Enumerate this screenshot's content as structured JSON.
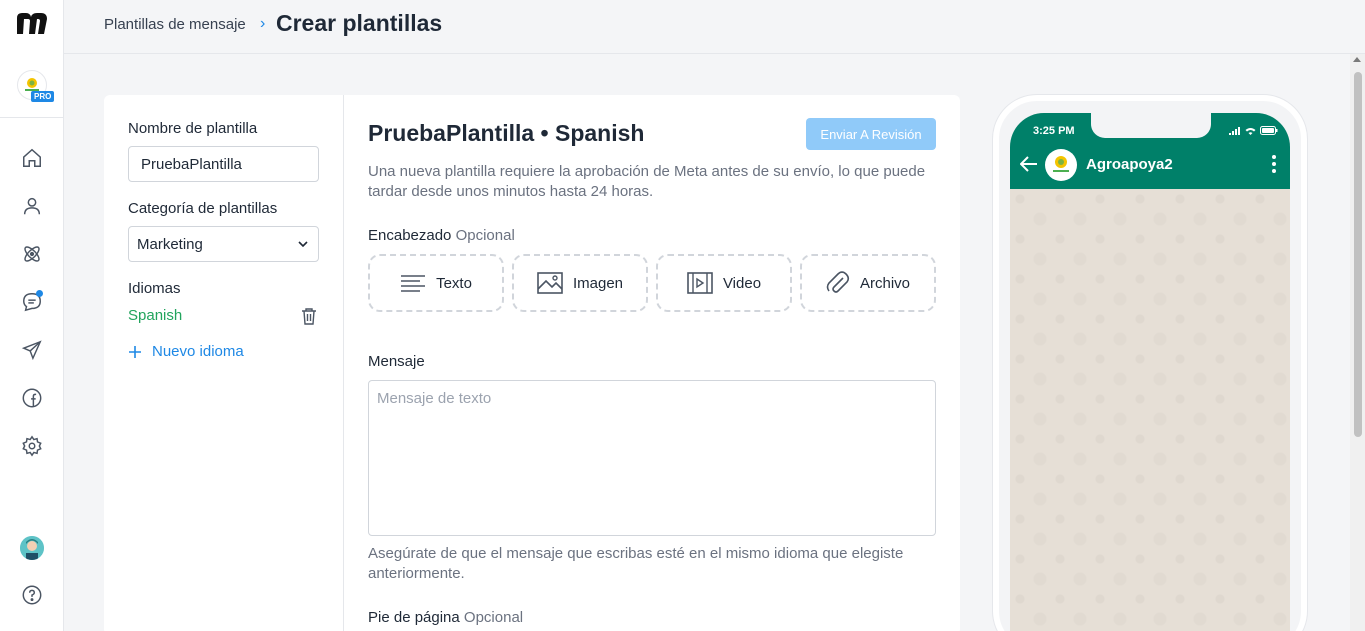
{
  "sidebar": {
    "logo": "m-logo",
    "org_badge": "PRO",
    "org_logo_text": "agroapoya2",
    "nav": [
      "home-icon",
      "user-icon",
      "atom-icon",
      "chat-icon",
      "send-icon",
      "facebook-icon",
      "gear-icon"
    ],
    "help_icon": "question-icon"
  },
  "header": {
    "breadcrumb": "Plantillas de mensaje",
    "title": "Crear plantillas"
  },
  "left_panel": {
    "name_label": "Nombre de plantilla",
    "name_value": "PruebaPlantilla",
    "category_label": "Categoría de plantillas",
    "category_value": "Marketing",
    "languages_label": "Idiomas",
    "languages": [
      "Spanish"
    ],
    "add_language": "Nuevo idioma"
  },
  "editor": {
    "title": "PruebaPlantilla • Spanish",
    "submit_button": "Enviar A Revisión",
    "description": "Una nueva plantilla requiere la aprobación de Meta antes de su envío, lo que puede tardar desde unos minutos hasta 24 horas.",
    "header_label": "Encabezado",
    "optional": "Opcional",
    "header_options": [
      "Texto",
      "Imagen",
      "Video",
      "Archivo"
    ],
    "message_label": "Mensaje",
    "message_placeholder": "Mensaje de texto",
    "message_hint": "Asegúrate de que el mensaje que escribas esté en el mismo idioma que elegiste anteriormente.",
    "footer_label": "Pie de página"
  },
  "preview": {
    "time": "3:25 PM",
    "contact_name": "Agroapoya2",
    "header_color": "#008069"
  },
  "colors": {
    "accent": "#1e88e5",
    "success": "#22a45d",
    "button_disabled": "#90caf9"
  }
}
